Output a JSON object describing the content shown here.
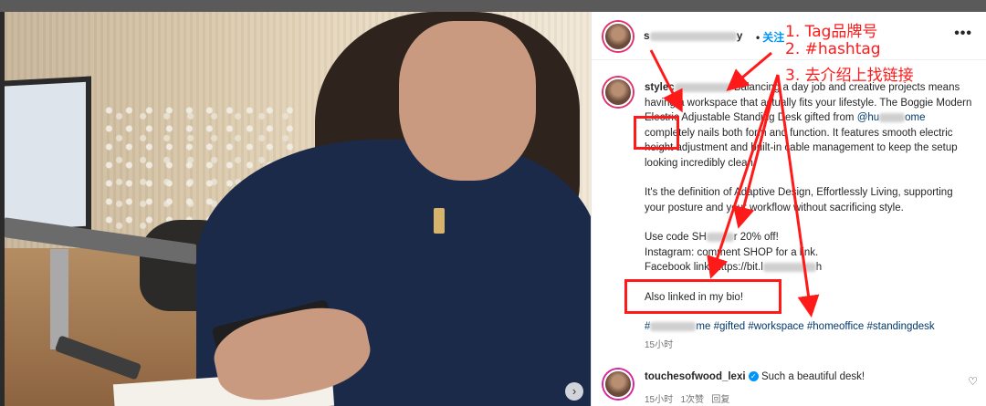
{
  "post": {
    "username_prefix": "s",
    "username_suffix": "y",
    "separator": "•",
    "follow_label": "关注",
    "more_label": "•••",
    "next_icon": "›"
  },
  "caption": {
    "username_prefix": "stylec",
    "line1_tail": "Balancing a day job and creative projects means having a workspace that actually fits your lifestyle. The Boggie Modern Electric Adjustable Standing Desk gifted from",
    "mention_prefix": "@hu",
    "mention_suffix": "ome",
    "line1_end": "completely nails both form and function. It features smooth electric height adjustment and built-in cable management to keep the setup looking incredibly clean.",
    "para2": "It's the definition of Adaptive Design, Effortlessly Living, supporting your posture and your workflow without sacrificing style.",
    "code_prefix": "Use code SH",
    "code_suffix": "r 20% off!",
    "instagram_line": "Instagram: comment SHOP for a link.",
    "facebook_prefix": "Facebook link: https://bit.l",
    "facebook_suffix": "h",
    "bio_line": "Also linked in my bio!",
    "hashtag_prefix": "#",
    "hashtag_first_suffix": "me",
    "hashtags_rest": "#gifted #workspace #homeoffice #standingdesk",
    "time": "15小时"
  },
  "comment": {
    "username": "touchesofwood_lexi",
    "verified_mark": "✓",
    "text": "Such a beautiful desk!",
    "time": "15小时",
    "likes": "1次赞",
    "reply": "回复",
    "heart_icon": "♡"
  },
  "annotations": {
    "step1": "1. Tag品牌号",
    "step2": "2. #hashtag",
    "step3": "3. 去介绍上找链接"
  },
  "colors": {
    "annotation_red": "#ff1a1a",
    "link_blue": "#0095f6",
    "hashtag_blue": "#00376b"
  }
}
